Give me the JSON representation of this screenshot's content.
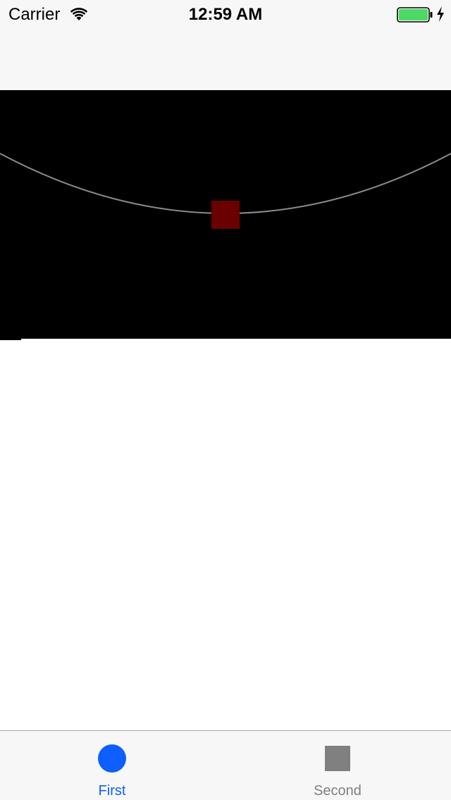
{
  "status_bar": {
    "carrier": "Carrier",
    "time": "12:59 AM",
    "wifi_icon": "wifi-icon",
    "battery_icon": "battery-full-icon",
    "charging_icon": "charging-bolt-icon",
    "battery_color": "#4cd964"
  },
  "canvas": {
    "background": "#000000",
    "curve_color": "#8a8a8a",
    "marker_color": "#6b0000"
  },
  "tab_bar": {
    "tabs": [
      {
        "label": "First",
        "icon": "circle-icon",
        "selected": true,
        "color": "#0d5fff"
      },
      {
        "label": "Second",
        "icon": "square-icon",
        "selected": false,
        "color": "#808080"
      }
    ]
  }
}
